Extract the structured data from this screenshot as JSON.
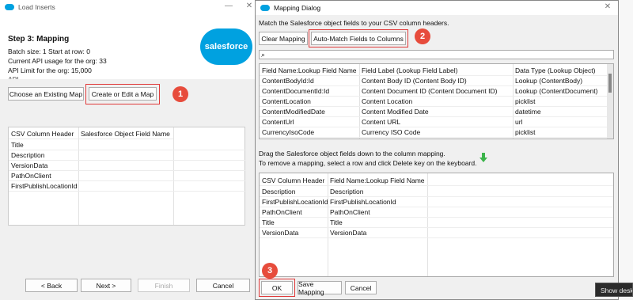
{
  "load_inserts": {
    "title": "Load Inserts",
    "step_title": "Step 3: Mapping",
    "batch_line": "Batch size: 1    Start at row: 0",
    "api_usage_line": "Current API usage for the org: 33",
    "api_limit_line": "API Limit for the org: 15,000",
    "api_cut_line": "API ...     ...",
    "logo_text": "salesforce",
    "choose_map_label": "Choose an Existing Map",
    "create_map_label": "Create or Edit a Map",
    "grid_headers": [
      "CSV Column Header",
      "Salesforce Object Field Name"
    ],
    "grid_rows": [
      "Title",
      "Description",
      "VersionData",
      "PathOnClient",
      "FirstPublishLocationId"
    ],
    "back_label": "< Back",
    "next_label": "Next >",
    "finish_label": "Finish",
    "cancel_label": "Cancel"
  },
  "mapping_dialog": {
    "title": "Mapping Dialog",
    "instruction": "Match the Salesforce object fields to your CSV column headers.",
    "clear_label": "Clear Mapping",
    "automatch_label": "Auto-Match Fields to Columns",
    "search_value": "",
    "field_headers": [
      "Field Name:Lookup Field Name",
      "Field Label (Lookup Field Label)",
      "Data Type (Lookup Object)"
    ],
    "field_rows": [
      [
        "ContentBodyId:Id",
        "Content Body ID (Content Body ID)",
        "Lookup (ContentBody)"
      ],
      [
        "ContentDocumentId:Id",
        "Content Document ID (Content Document ID)",
        "Lookup (ContentDocument)"
      ],
      [
        "ContentLocation",
        "Content Location",
        "picklist"
      ],
      [
        "ContentModifiedDate",
        "Content Modified Date",
        "datetime"
      ],
      [
        "ContentUrl",
        "Content URL",
        "url"
      ],
      [
        "CurrencyIsoCode",
        "Currency ISO Code",
        "picklist"
      ]
    ],
    "drag_line1": "Drag the Salesforce object fields down to the column mapping.",
    "drag_line2": "To remove a mapping, select a row and click Delete key on the keyboard.",
    "map_headers": [
      "CSV Column Header",
      "Field Name:Lookup Field Name"
    ],
    "map_rows": [
      [
        "Description",
        "Description"
      ],
      [
        "FirstPublishLocationId",
        "FirstPublishLocationId"
      ],
      [
        "PathOnClient",
        "PathOnClient"
      ],
      [
        "Title",
        "Title"
      ],
      [
        "VersionData",
        "VersionData"
      ]
    ],
    "ok_label": "OK",
    "save_label": "Save Mapping",
    "cancel_label": "Cancel"
  },
  "badges": [
    "1",
    "2",
    "3"
  ],
  "tooltip": "Show desk",
  "colors": {
    "highlight": "#e03a3a",
    "badge": "#e74c3c",
    "brand": "#00a1e0",
    "arrow": "#3cb44a"
  }
}
